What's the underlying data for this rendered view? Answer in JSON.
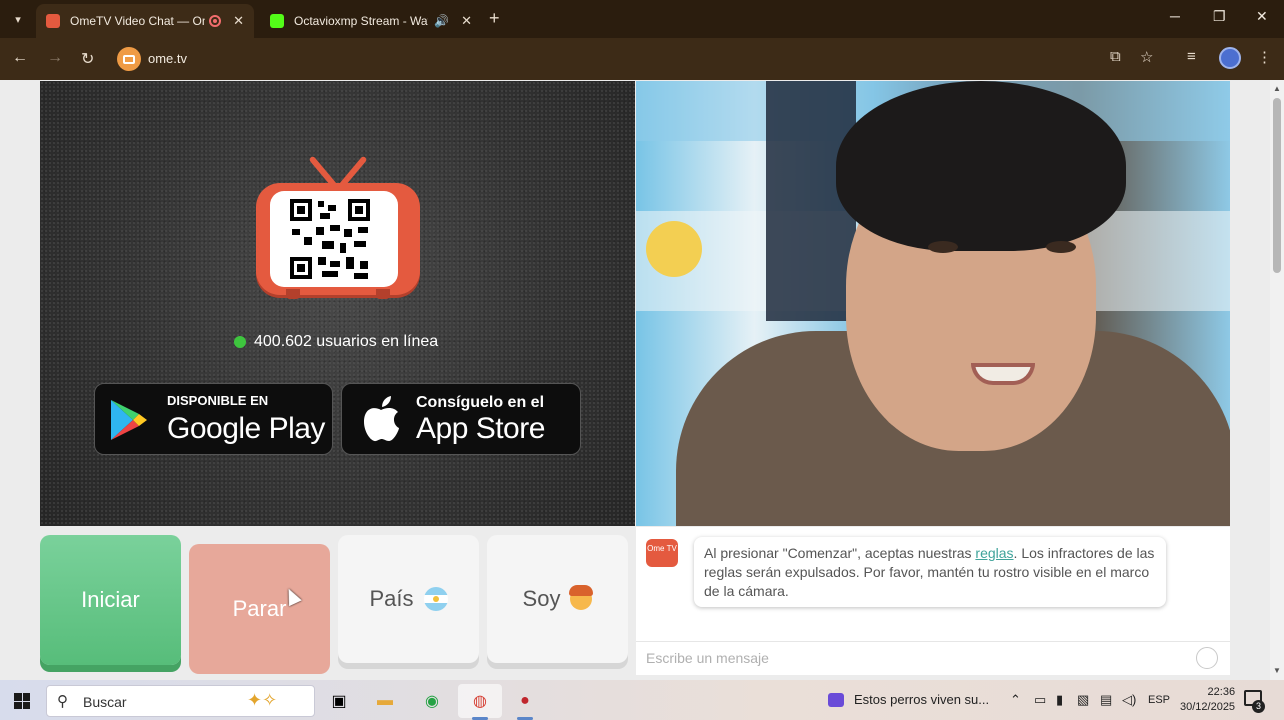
{
  "browser": {
    "tabs": [
      {
        "title": "OmeTV Video Chat — Ome",
        "active": true
      },
      {
        "title": "Octavioxmp Stream - Watch",
        "active": false
      }
    ],
    "url": "ome.tv"
  },
  "promo": {
    "online_count_text": "400.602 usuarios en línea",
    "google_play": {
      "small": "DISPONIBLE EN",
      "big": "Google Play"
    },
    "app_store": {
      "small": "Consíguelo en el",
      "big": "App Store"
    }
  },
  "controls": {
    "start_label": "Iniciar",
    "stop_label": "Parar",
    "country_label": "País",
    "soy_label": "Soy"
  },
  "chat": {
    "logo_text": "Ome TV",
    "system_message_before_link": "Al presionar \"Comenzar\", aceptas nuestras ",
    "system_message_link": "reglas",
    "system_message_after_link": ". Los infractores de las reglas serán expulsados. Por favor, mantén tu rostro visible en el marco de la cámara.",
    "input_placeholder": "Escribe un mensaje"
  },
  "taskbar": {
    "search_placeholder": "Buscar",
    "news_text": "Estos perros viven su...",
    "language": "ESP",
    "time": "22:36",
    "date": "30/12/2025",
    "notification_count": "3"
  },
  "colors": {
    "brand_red": "#e45a3f",
    "start_green": "#57bd7a",
    "stop_salmon": "#e7a89a",
    "online_dot": "#3ec53e",
    "link_teal": "#3fa39a"
  }
}
